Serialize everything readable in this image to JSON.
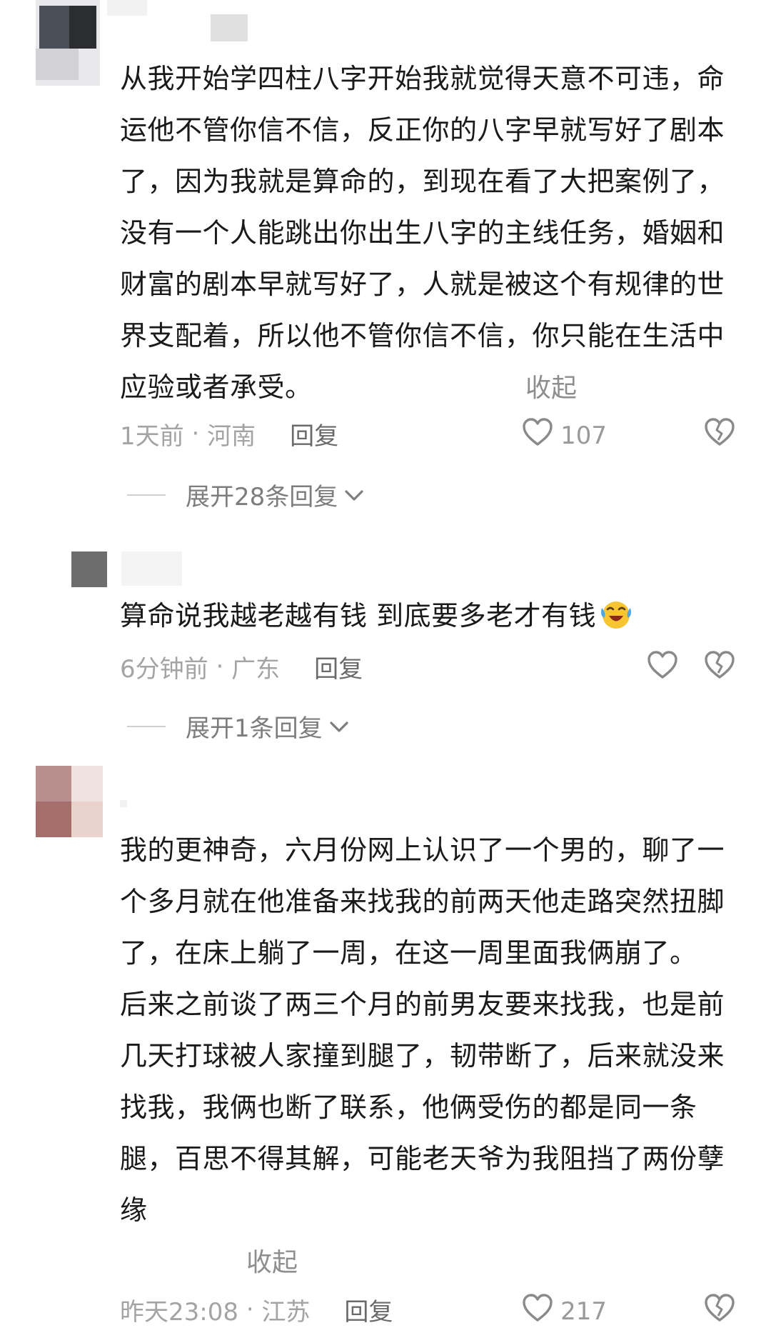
{
  "comments": [
    {
      "paragraphs": [
        "从我开始学四柱八字开始我就觉得天意不可违，命运他不管你信不信，反正你的八字早就写好了剧本了，因为我就是算命的，到现在看了大把案例了，没有一个人能跳出你出生八字的主线任务，婚姻和财富的剧本早就写好了，人就是被这个有规律的世界支配着，所以他不管你信不信，你只能在生活中应验或者承受。"
      ],
      "collapse_label": "收起",
      "time": "1天前",
      "separator": " · ",
      "location": "河南",
      "reply_label": "回复",
      "likes": "107",
      "expand_label": "展开28条回复"
    },
    {
      "paragraphs": [
        "算命说我越老越有钱 到底要多老才有钱"
      ],
      "emoji": "laughing-crying-emoji",
      "time": "6分钟前",
      "separator": " · ",
      "location": "广东",
      "reply_label": "回复",
      "expand_label": "展开1条回复"
    },
    {
      "paragraphs": [
        "我的更神奇，六月份网上认识了一个男的，聊了一个多月就在他准备来找我的前两天他走路突然扭脚了，在床上躺了一周，在这一周里面我俩崩了。",
        "后来之前谈了两三个月的前男友要来找我，也是前几天打球被人家撞到腿了，韧带断了，后来就没来找我，我俩也断了联系，他俩受伤的都是同一条腿，百思不得其解，可能老天爷为我阻挡了两份孽缘"
      ],
      "collapse_label": "收起",
      "time": "昨天23:08",
      "separator": " · ",
      "location": "江苏",
      "reply_label": "回复",
      "likes": "217"
    }
  ],
  "icons": {
    "like": "heart-outline-icon",
    "dislike": "broken-heart-icon",
    "expand": "chevron-down-icon"
  },
  "colors": {
    "text": "#1a1a1a",
    "meta": "#a4a4a4",
    "reply": "#6a6a6a",
    "icon": "#8a8a8a"
  }
}
